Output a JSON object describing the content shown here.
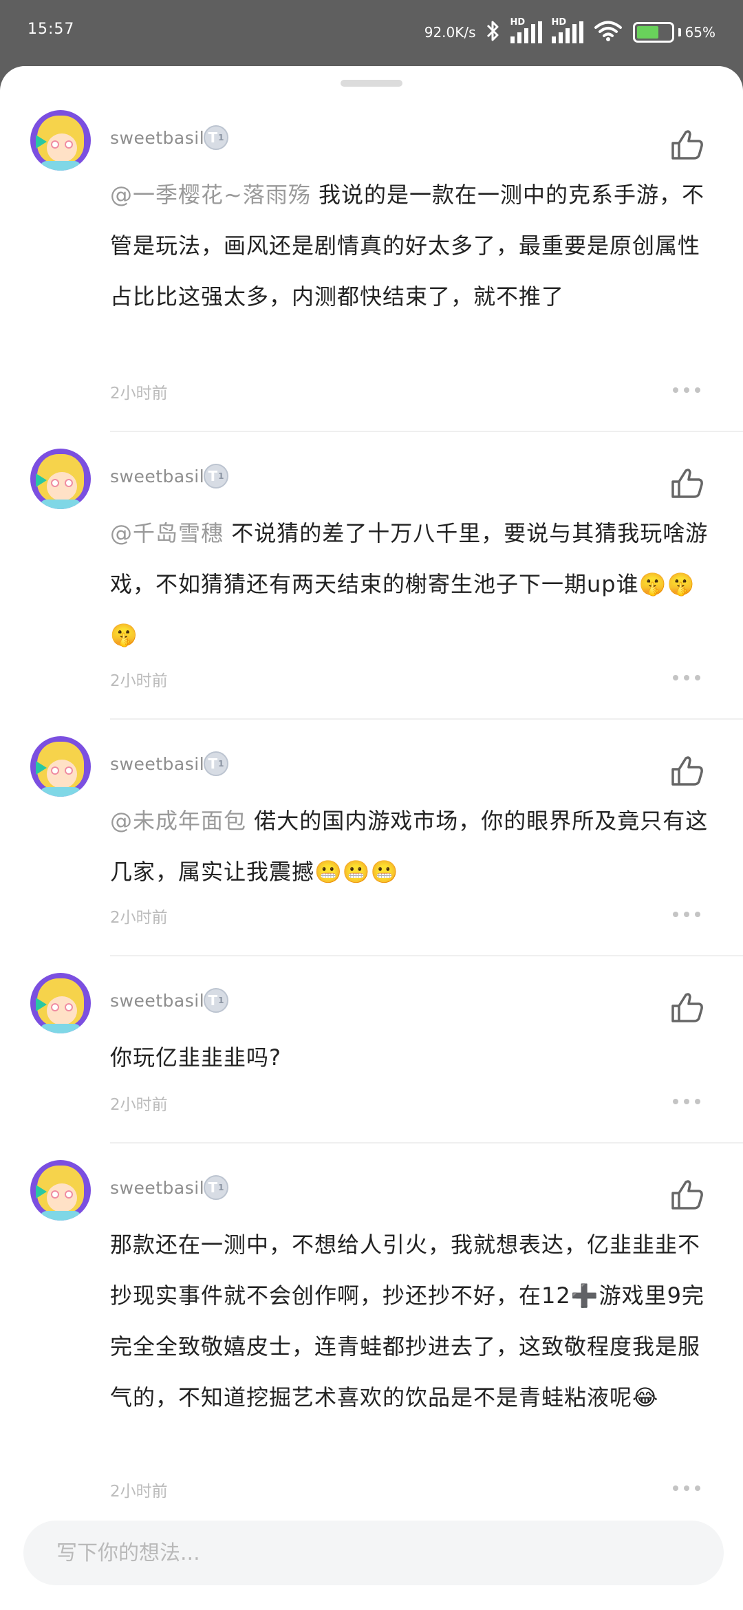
{
  "status_bar": {
    "time": "15:57",
    "net_speed": "92.0K/s",
    "battery": "65%",
    "battery_level": 0.65,
    "signal_labels": [
      "HD",
      "HD"
    ]
  },
  "comments": [
    {
      "username": "sweetbasil",
      "badge": "T",
      "badge_level": "1",
      "mention": "@一季樱花~落雨殇",
      "text": "我说的是一款在一测中的克系手游，不管是玩法，画风还是剧情真的好太多了，最重要是原创属性占比比这强太多，内测都快结束了，就不推了",
      "time": "2小时前"
    },
    {
      "username": "sweetbasil",
      "badge": "T",
      "badge_level": "1",
      "mention": "@千岛雪穗",
      "text": "不说猜的差了十万八千里，要说与其猜我玩啥游戏，不如猜猜还有两天结束的榭寄生池子下一期up谁🤫🤫🤫",
      "time": "2小时前"
    },
    {
      "username": "sweetbasil",
      "badge": "T",
      "badge_level": "1",
      "mention": "@未成年面包",
      "text": "偌大的国内游戏市场，你的眼界所及竟只有这几家，属实让我震撼😬😬😬",
      "time": "2小时前"
    },
    {
      "username": "sweetbasil",
      "badge": "T",
      "badge_level": "1",
      "mention": "",
      "text": "你玩亿韭韭韭吗?",
      "time": "2小时前"
    },
    {
      "username": "sweetbasil",
      "badge": "T",
      "badge_level": "1",
      "mention": "",
      "text": "那款还在一测中，不想给人引火，我就想表达，亿韭韭韭不抄现实事件就不会创作啊，抄还抄不好，在12➕游戏里9完完全全致敬嬉皮士，连青蛙都抄进去了，这致敬程度我是服气的，不知道挖掘艺术喜欢的饮品是不是青蛙粘液呢😂",
      "time": "2小时前"
    }
  ],
  "input": {
    "placeholder": "写下你的想法..."
  },
  "icons": {
    "like": "thumbs-up-icon",
    "more": "more-dots-icon",
    "bluetooth": "bluetooth-icon",
    "wifi": "wifi-icon"
  }
}
